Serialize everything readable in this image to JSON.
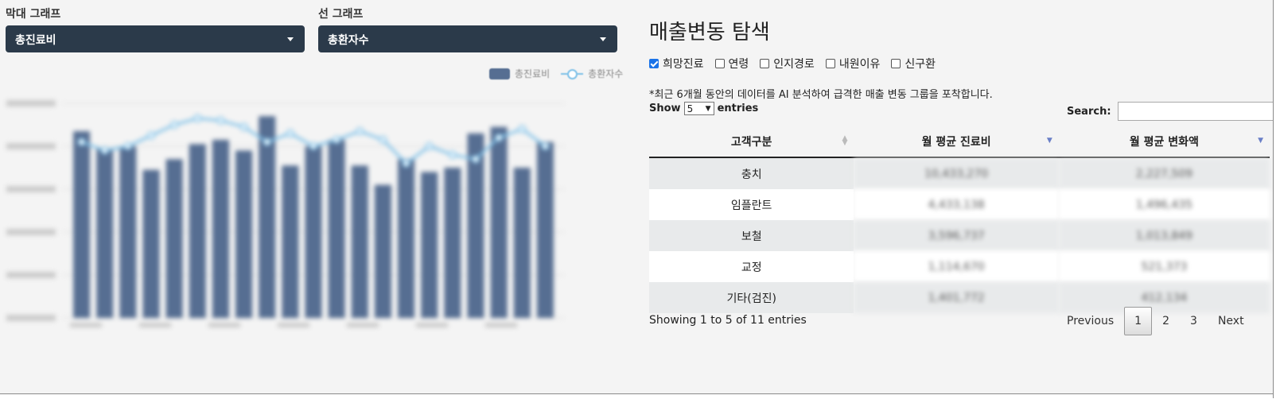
{
  "bar_select": {
    "label": "막대 그래프",
    "value": "총진료비"
  },
  "line_select": {
    "label": "선 그래프",
    "value": "총환자수"
  },
  "legend": {
    "bar": "총진료비",
    "line": "총환자수"
  },
  "colors": {
    "bar": "#566e92",
    "line": "#7fc1e8",
    "select_bg": "#2b3a4a",
    "accent": "#1a73e8"
  },
  "chart_data": {
    "type": "bar",
    "series": [
      {
        "name": "총진료비",
        "type": "bar",
        "values": [
          0.87,
          0.79,
          0.8,
          0.69,
          0.74,
          0.81,
          0.83,
          0.78,
          0.94,
          0.71,
          0.8,
          0.83,
          0.71,
          0.62,
          0.74,
          0.68,
          0.7,
          0.86,
          0.89,
          0.7,
          0.82
        ]
      },
      {
        "name": "총환자수",
        "type": "line",
        "values": [
          0.82,
          0.78,
          0.8,
          0.85,
          0.9,
          0.93,
          0.92,
          0.89,
          0.82,
          0.86,
          0.8,
          0.83,
          0.87,
          0.83,
          0.72,
          0.8,
          0.76,
          0.74,
          0.84,
          0.88,
          0.8
        ]
      }
    ]
  },
  "explorer": {
    "title": "매출변동 탐색",
    "checkboxes": [
      {
        "label": "희망진료",
        "checked": true
      },
      {
        "label": "연령",
        "checked": false
      },
      {
        "label": "인지경로",
        "checked": false
      },
      {
        "label": "내원이유",
        "checked": false
      },
      {
        "label": "신구환",
        "checked": false
      }
    ],
    "note": "*최근 6개월 동안의 데이터를 AI 분석하여 급격한 매출 변동 그룹을 포착합니다.",
    "show_label": "Show",
    "show_value": "5",
    "entries_label": "entries",
    "search_label": "Search:",
    "columns": [
      "고객구분",
      "월 평균 진료비",
      "월 평균 변화액"
    ],
    "rows": [
      {
        "group": "충치",
        "avg": "10,433,270",
        "delta": "2,227,509"
      },
      {
        "group": "임플란트",
        "avg": "4,433,138",
        "delta": "1,496,435"
      },
      {
        "group": "보철",
        "avg": "3,596,737",
        "delta": "1,013,849"
      },
      {
        "group": "교정",
        "avg": "1,114,670",
        "delta": "521,373"
      },
      {
        "group": "기타(검진)",
        "avg": "1,401,772",
        "delta": "412,134"
      }
    ],
    "info": "Showing 1 to 5 of 11 entries",
    "pager": {
      "previous": "Previous",
      "pages": [
        "1",
        "2",
        "3"
      ],
      "next": "Next"
    }
  }
}
